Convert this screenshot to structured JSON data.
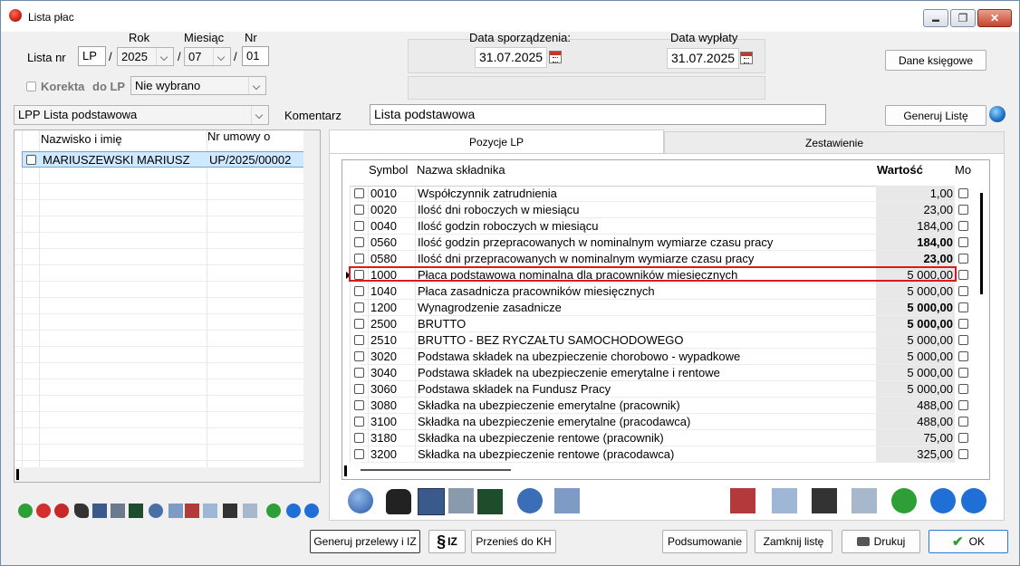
{
  "window": {
    "title": "Lista płac",
    "minimize": "▬",
    "maximize": "❐",
    "close": "✕"
  },
  "header": {
    "lista_nr_label": "Lista nr",
    "rok_label": "Rok",
    "miesiac_label": "Miesiąc",
    "nr_label": "Nr",
    "prefix": "LP",
    "slash": "/",
    "year": "2025",
    "month": "07",
    "number": "01",
    "korekta_label": "Korekta",
    "do_lp_label": "do LP",
    "do_lp_value": "Nie wybrano",
    "data_sporzadzenia_label": "Data sporządzenia:",
    "data_sporzadzenia": "31.07.2025",
    "data_wyplaty_label": "Data wypłaty",
    "data_wyplaty": "31.07.2025",
    "dane_ksiegowe": "Dane księgowe",
    "list_type": "LPP Lista podstawowa",
    "komentarz_label": "Komentarz",
    "komentarz": "Lista podstawowa",
    "generuj_liste": "Generuj Listę"
  },
  "employees": {
    "col_name": "Nazwisko i imię",
    "col_contract": "Nr umowy o pracę",
    "rows": [
      {
        "name": "MARIUSZEWSKI MARIUSZ",
        "contract": "UP/2025/00002"
      }
    ]
  },
  "tabs": [
    {
      "label": "Pozycje LP"
    },
    {
      "label": "Zestawienie"
    }
  ],
  "components": {
    "col_symbol": "Symbol",
    "col_name": "Nazwa składnika",
    "col_value": "Wartość",
    "col_mo": "Mo",
    "rows": [
      {
        "symbol": "0010",
        "name": "Współczynnik zatrudnienia",
        "value": "1,00",
        "bold": false
      },
      {
        "symbol": "0020",
        "name": "Ilość dni roboczych w miesiącu",
        "value": "23,00",
        "bold": false
      },
      {
        "symbol": "0040",
        "name": "Ilość godzin roboczych w miesiącu",
        "value": "184,00",
        "bold": false
      },
      {
        "symbol": "0560",
        "name": "Ilość godzin przepracowanych w nominalnym wymiarze czasu pracy",
        "value": "184,00",
        "bold": true
      },
      {
        "symbol": "0580",
        "name": "Ilość dni przepracowanych w nominalnym wymiarze czasu pracy",
        "value": "23,00",
        "bold": true
      },
      {
        "symbol": "1000",
        "name": "Płaca podstawowa nominalna dla pracowników miesięcznych",
        "value": "5 000,00",
        "bold": false
      },
      {
        "symbol": "1040",
        "name": "Płaca zasadnicza pracowników miesięcznych",
        "value": "5 000,00",
        "bold": false
      },
      {
        "symbol": "1200",
        "name": "Wynagrodzenie zasadnicze",
        "value": "5 000,00",
        "bold": true
      },
      {
        "symbol": "2500",
        "name": "BRUTTO",
        "value": "5 000,00",
        "bold": true
      },
      {
        "symbol": "2510",
        "name": "BRUTTO - BEZ RYCZAŁTU SAMOCHODOWEGO",
        "value": "5 000,00",
        "bold": false
      },
      {
        "symbol": "3020",
        "name": "Podstawa składek na ubezpieczenie chorobowo - wypadkowe",
        "value": "5 000,00",
        "bold": false
      },
      {
        "symbol": "3040",
        "name": "Podstawa składek na ubezpieczenie emerytalne i rentowe",
        "value": "5 000,00",
        "bold": false
      },
      {
        "symbol": "3060",
        "name": "Podstawa składek na Fundusz Pracy",
        "value": "5 000,00",
        "bold": false
      },
      {
        "symbol": "3080",
        "name": "Składka na ubezpieczenie emerytalne (pracownik)",
        "value": "488,00",
        "bold": false
      },
      {
        "symbol": "3100",
        "name": "Składka na ubezpieczenie emerytalne (pracodawca)",
        "value": "488,00",
        "bold": false
      },
      {
        "symbol": "3180",
        "name": "Składka na ubezpieczenie rentowe (pracownik)",
        "value": "75,00",
        "bold": false
      },
      {
        "symbol": "3200",
        "name": "Składka na ubezpieczenie rentowe (pracodawca)",
        "value": "325,00",
        "bold": false
      }
    ]
  },
  "footer": {
    "generuj_przelewy": "Generuj przelewy i IZ",
    "iz": "IZ",
    "przenies": "Przenieś do KH",
    "podsumowanie": "Podsumowanie",
    "zamknij": "Zamknij listę",
    "drukuj": "Drukuj",
    "ok": "OK"
  },
  "colors": {
    "highlight": "#e0181c",
    "selection": "#cde8ff",
    "accent": "#1f6fd6"
  }
}
